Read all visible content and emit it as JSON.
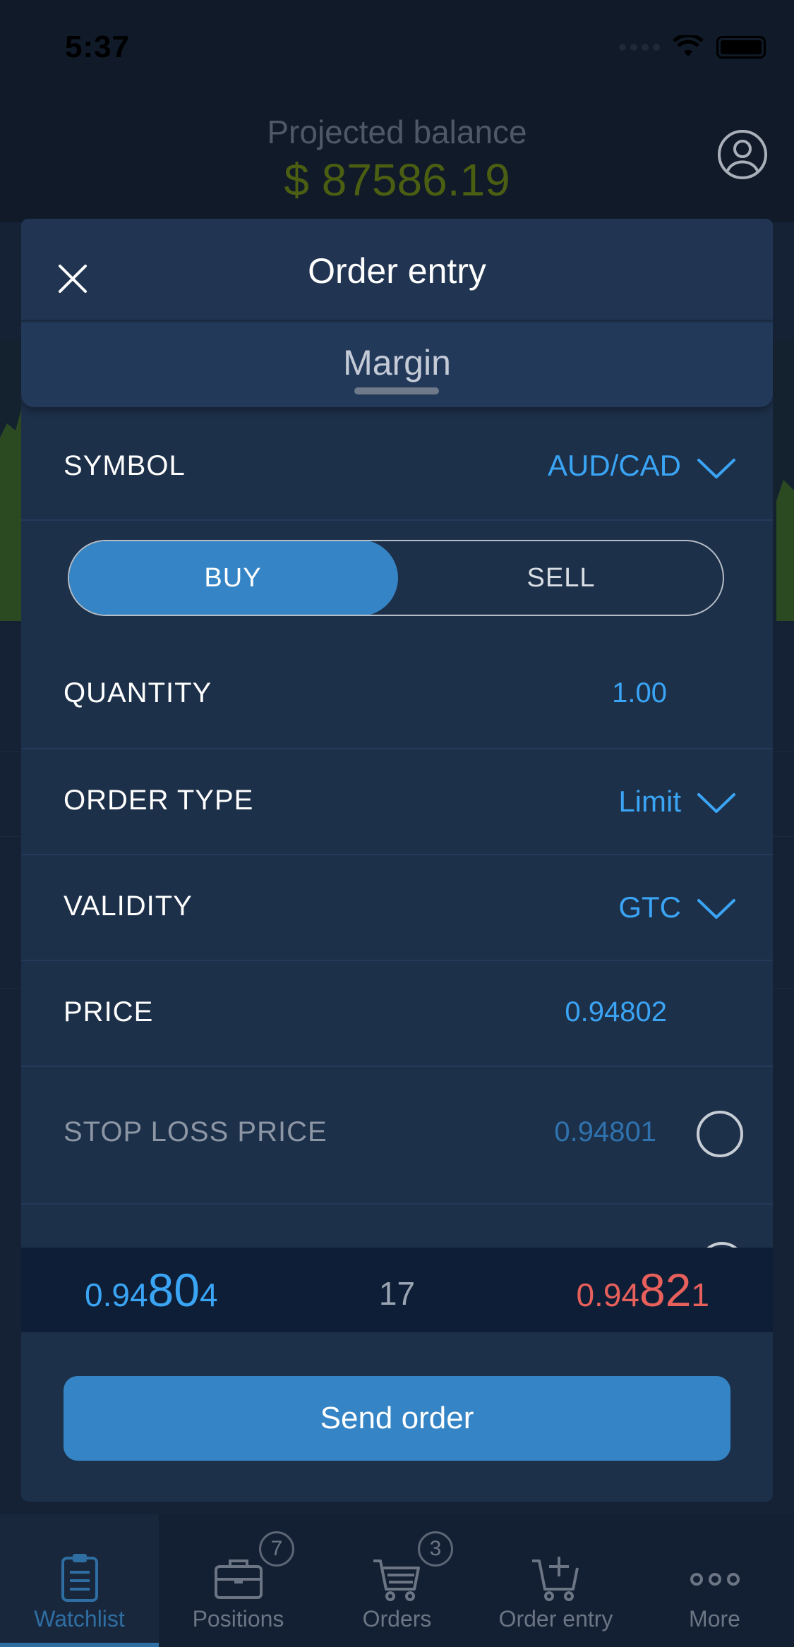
{
  "status_bar": {
    "time": "5:37"
  },
  "header": {
    "label": "Projected balance",
    "balance": "$ 87586.19"
  },
  "modal": {
    "title": "Order entry",
    "segment": "Margin",
    "symbol": {
      "label": "SYMBOL",
      "value": "AUD/CAD"
    },
    "side": {
      "buy": "BUY",
      "sell": "SELL",
      "selected": "BUY"
    },
    "quantity": {
      "label": "QUANTITY",
      "value": "1.00"
    },
    "order_type": {
      "label": "ORDER TYPE",
      "value": "Limit"
    },
    "validity": {
      "label": "VALIDITY",
      "value": "GTC"
    },
    "price": {
      "label": "PRICE",
      "value": "0.94802"
    },
    "stop_loss": {
      "label": "STOP LOSS PRICE",
      "value": "0.94801",
      "enabled": false
    },
    "quote": {
      "bid_prefix": "0.94",
      "bid_big": "80",
      "bid_suffix": "4",
      "spread": "17",
      "ask_prefix": "0.94",
      "ask_big": "82",
      "ask_suffix": "1"
    },
    "send_button": "Send order"
  },
  "tabbar": {
    "tabs": [
      {
        "label": "Watchlist",
        "icon": "clipboard-list-icon",
        "active": true
      },
      {
        "label": "Positions",
        "icon": "briefcase-icon",
        "badge": "7"
      },
      {
        "label": "Orders",
        "icon": "cart-icon",
        "badge": "3"
      },
      {
        "label": "Order entry",
        "icon": "cart-plus-icon"
      },
      {
        "label": "More",
        "icon": "more-dots-icon"
      }
    ]
  },
  "colors": {
    "accent": "#3585c6",
    "value_blue": "#3aa4f5",
    "ask_red": "#e8605c",
    "balance_green": "#4b5e12"
  }
}
